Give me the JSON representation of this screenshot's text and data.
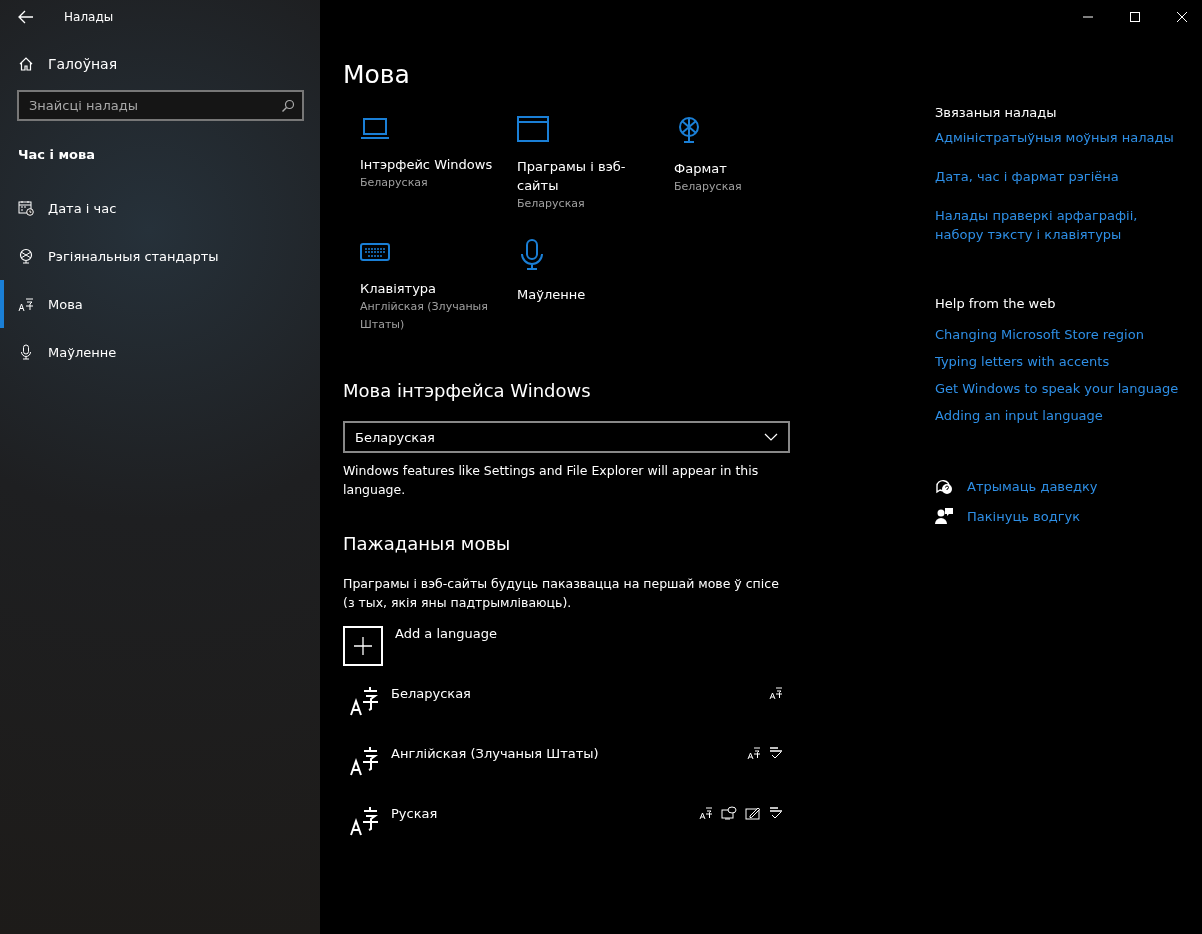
{
  "window": {
    "title": "Налады"
  },
  "sidebar": {
    "home": "Галоўная",
    "search": {
      "placeholder": "Знайсці налады"
    },
    "section": "Час і мова",
    "items": [
      {
        "label": "Дата і час",
        "kind": "calendar",
        "selected": false
      },
      {
        "label": "Рэгіянальныя стандарты",
        "kind": "globe",
        "selected": false
      },
      {
        "label": "Мова",
        "kind": "language",
        "selected": true
      },
      {
        "label": "Маўленне",
        "kind": "mic",
        "selected": false
      }
    ]
  },
  "page": {
    "title": "Мова",
    "tiles": [
      {
        "kind": "laptop",
        "title": "Інтэрфейс Windows",
        "subtitle": "Беларуская"
      },
      {
        "kind": "window",
        "title": "Праграмы і вэб-сайты",
        "subtitle": "Беларуская"
      },
      {
        "kind": "globe",
        "title": "Фармат",
        "subtitle": "Беларуская"
      },
      {
        "kind": "keyboard",
        "title": "Клавіятура",
        "subtitle": "Англійская (Злучаныя Штаты)"
      },
      {
        "kind": "mic",
        "title": "Маўленне"
      }
    ],
    "display_language": {
      "heading": "Мова інтэрфейса Windows",
      "value": "Беларуская",
      "note": "Windows features like Settings and File Explorer will appear in this language."
    },
    "preferred": {
      "heading": "Пажаданыя мовы",
      "note": "Праграмы і вэб-сайты будуць паказвацца на першай мове ў спісе (з тых, якія яны падтрымліваюць).",
      "add": "Add a language",
      "languages": [
        {
          "name": "Беларуская",
          "features": [
            {
              "kind": "display"
            }
          ]
        },
        {
          "name": "Англійская (Злучаныя Штаты)",
          "features": [
            {
              "kind": "display"
            },
            {
              "kind": "spelling"
            }
          ]
        },
        {
          "name": "Руская",
          "features": [
            {
              "kind": "display"
            },
            {
              "kind": "speech"
            },
            {
              "kind": "handwriting"
            },
            {
              "kind": "spelling"
            }
          ]
        }
      ]
    }
  },
  "related": {
    "heading": "Звязаныя налады",
    "links": [
      "Адміністратыўныя моўныя налады",
      "Дата, час і фармат рэгіёна",
      "Налады праверкі арфаграфіі, набору тэксту і клавіятуры"
    ]
  },
  "help": {
    "heading": "Help from the web",
    "links": [
      "Changing Microsoft Store region",
      "Typing letters with accents",
      "Get Windows to speak your language",
      "Adding an input language"
    ]
  },
  "support": [
    {
      "kind": "help",
      "label": "Атрымаць даведку"
    },
    {
      "kind": "feedback",
      "label": "Пакінуць водгук"
    }
  ]
}
